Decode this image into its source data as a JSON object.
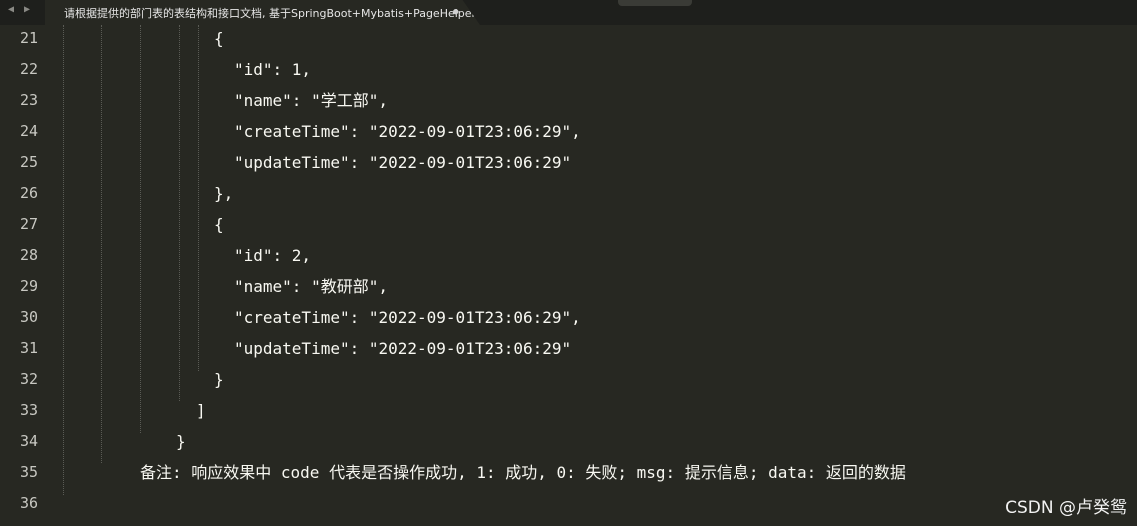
{
  "tab": {
    "title": "请根据提供的部门表的表结构和接口文档, 基于SpringBoot+Mybatis+PageHelper",
    "dirty_marker": "●",
    "nav_arrows": "◀ ▶"
  },
  "editor": {
    "lines": [
      {
        "number": "21",
        "text": "{"
      },
      {
        "number": "22",
        "text": "\"id\": 1,"
      },
      {
        "number": "23",
        "text": "\"name\": \"学工部\","
      },
      {
        "number": "24",
        "text": "\"createTime\": \"2022-09-01T23:06:29\","
      },
      {
        "number": "25",
        "text": "\"updateTime\": \"2022-09-01T23:06:29\""
      },
      {
        "number": "26",
        "text": "},"
      },
      {
        "number": "27",
        "text": "{"
      },
      {
        "number": "28",
        "text": "\"id\": 2,"
      },
      {
        "number": "29",
        "text": "\"name\": \"教研部\","
      },
      {
        "number": "30",
        "text": "\"createTime\": \"2022-09-01T23:06:29\","
      },
      {
        "number": "31",
        "text": "\"updateTime\": \"2022-09-01T23:06:29\""
      },
      {
        "number": "32",
        "text": "}"
      },
      {
        "number": "33",
        "text": "]"
      },
      {
        "number": "34",
        "text": "}"
      },
      {
        "number": "35",
        "text": "备注: 响应效果中 code 代表是否操作成功, 1: 成功, 0: 失败; msg: 提示信息; data: 返回的数据"
      },
      {
        "number": "36",
        "text": ""
      }
    ]
  },
  "watermark": "CSDN @卢癸鸳",
  "colors": {
    "background": "#272822",
    "tabbar": "#1e1f1c",
    "text": "#f8f8f2",
    "gutter_text": "#c8c8c2"
  }
}
